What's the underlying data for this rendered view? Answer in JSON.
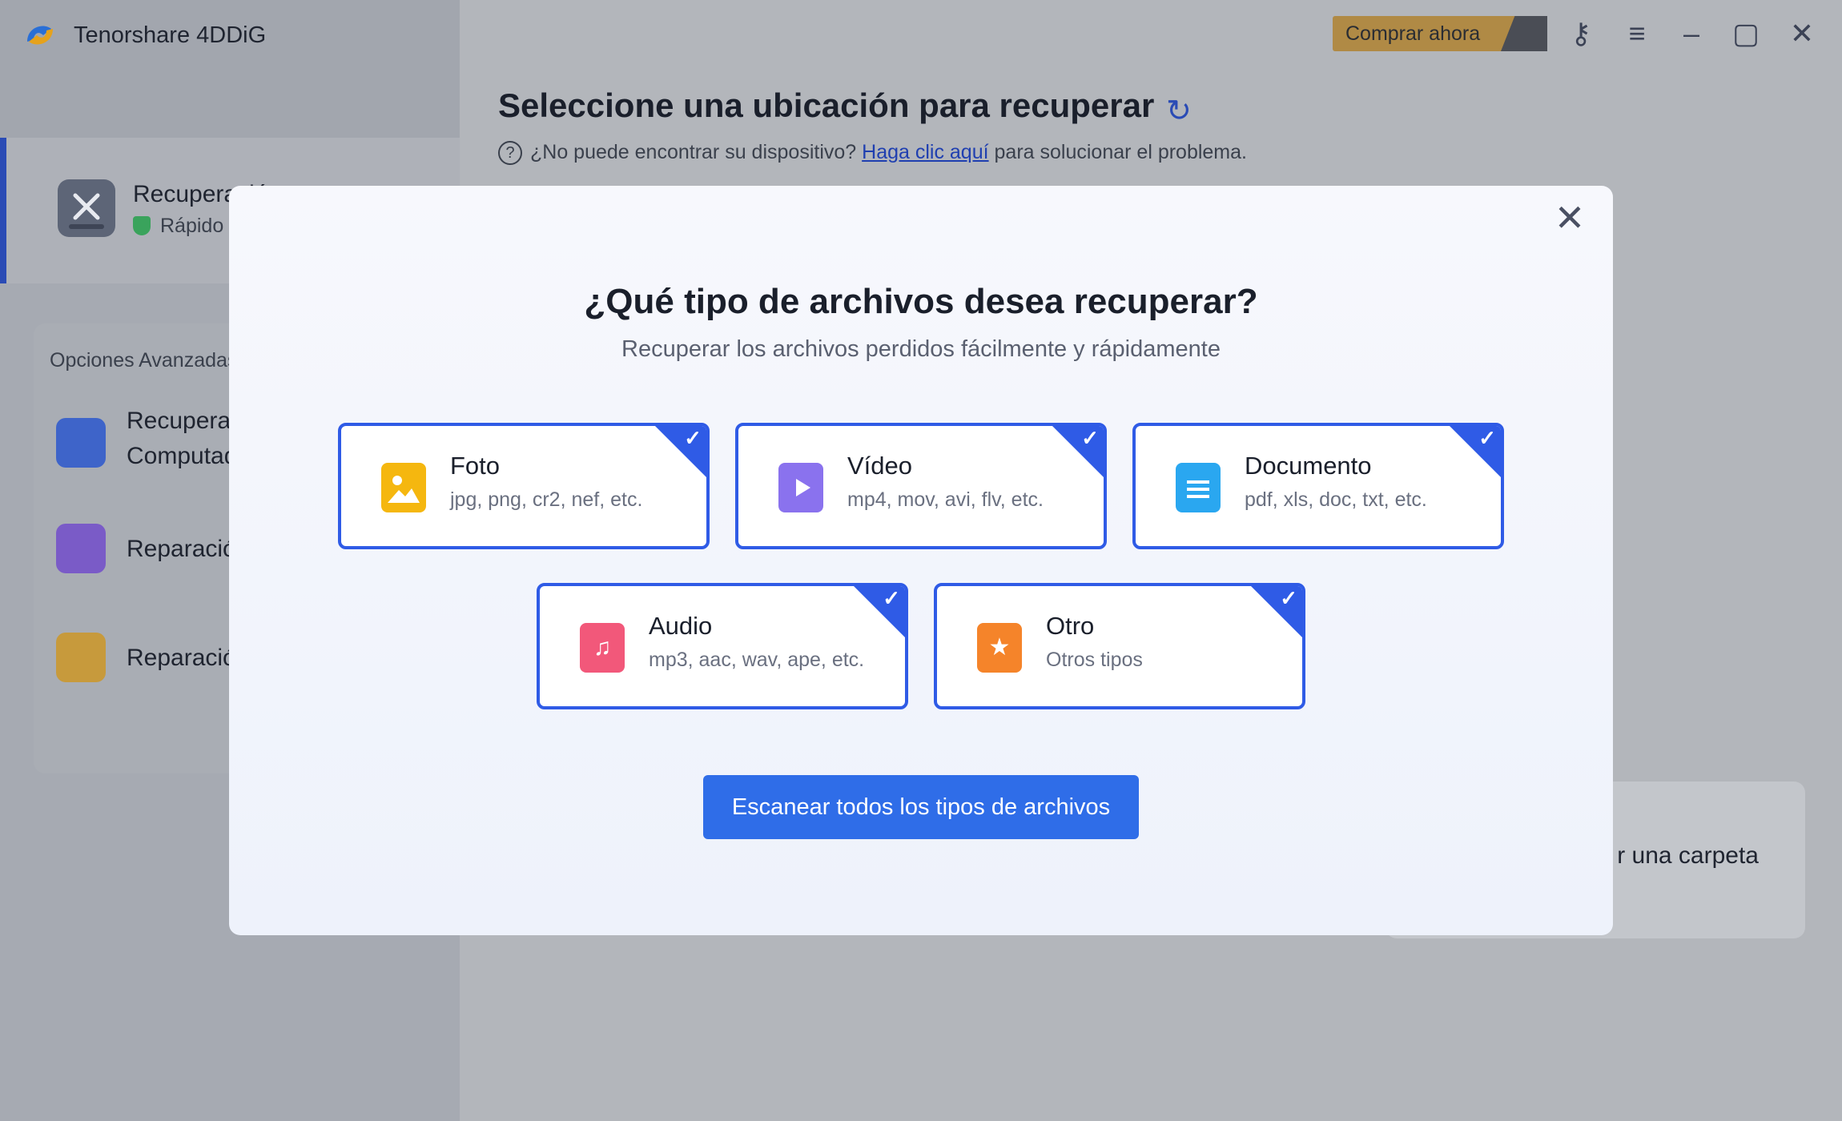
{
  "app": {
    "title": "Tenorshare 4DDiG"
  },
  "topbar": {
    "buy_label": "Comprar ahora"
  },
  "sidebar": {
    "main_item": {
      "title": "Recuperación",
      "subtitle": "Rápido y"
    },
    "advanced_title": "Opciones Avanzadas",
    "advanced_items": [
      {
        "label_line1": "Recuperar",
        "label_line2": "Computad"
      },
      {
        "label_line1": "Reparació",
        "label_line2": ""
      },
      {
        "label_line1": "Reparació",
        "label_line2": ""
      }
    ]
  },
  "main": {
    "title": "Seleccione una ubicación para recuperar",
    "help_prefix": "¿No puede encontrar su dispositivo?",
    "help_link": "Haga clic aquí",
    "help_suffix": "para solucionar el problema.",
    "folder_card_text": "r una carpeta"
  },
  "modal": {
    "title": "¿Qué tipo de archivos desea recuperar?",
    "subtitle": "Recuperar los archivos perdidos fácilmente y rápidamente",
    "file_types": [
      {
        "title": "Foto",
        "desc": "jpg, png, cr2, nef, etc.",
        "icon": "image-icon",
        "color": "#f5b70f",
        "checked": true
      },
      {
        "title": "Vídeo",
        "desc": "mp4, mov, avi, flv, etc.",
        "icon": "video-icon",
        "color": "#8a72ee",
        "checked": true
      },
      {
        "title": "Documento",
        "desc": "pdf, xls, doc, txt, etc.",
        "icon": "document-icon",
        "color": "#2aa7f0",
        "checked": true
      },
      {
        "title": "Audio",
        "desc": "mp3, aac, wav, ape, etc.",
        "icon": "music-icon",
        "color": "#f2587a",
        "checked": true
      },
      {
        "title": "Otro",
        "desc": "Otros tipos",
        "icon": "star-icon",
        "color": "#f5842a",
        "checked": true
      }
    ],
    "scan_button": "Escanear todos los tipos de archivos"
  },
  "colors": {
    "accent": "#2f5be6",
    "button": "#2f6de8"
  }
}
